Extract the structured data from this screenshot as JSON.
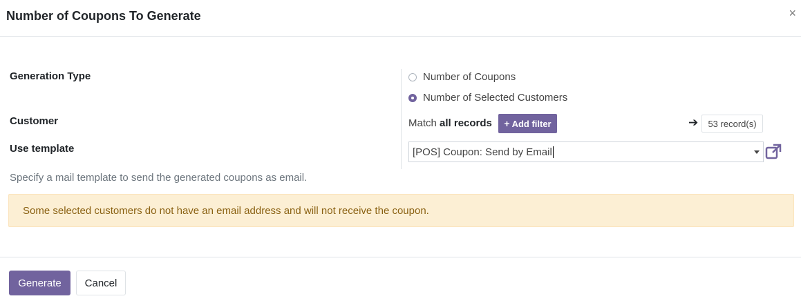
{
  "dialog": {
    "title": "Number of Coupons To Generate",
    "close_icon": "×"
  },
  "form": {
    "generation_type": {
      "label": "Generation Type",
      "options": [
        {
          "label": "Number of Coupons",
          "selected": false
        },
        {
          "label": "Number of Selected Customers",
          "selected": true
        }
      ]
    },
    "customer": {
      "label": "Customer",
      "match_prefix": "Match",
      "match_scope": "all records",
      "add_filter_label": "Add filter",
      "add_filter_icon": "+",
      "records_arrow": "➔",
      "records_count": "53 record(s)"
    },
    "use_template": {
      "label": "Use template",
      "value": "[POS] Coupon: Send by Email",
      "help": "Specify a mail template to send the generated coupons as email."
    }
  },
  "alert": {
    "text": "Some selected customers do not have an email address and will not receive the coupon."
  },
  "footer": {
    "generate_label": "Generate",
    "cancel_label": "Cancel"
  },
  "colors": {
    "primary": "#71639e",
    "alert_bg": "#fcefd4",
    "alert_text": "#8a6112"
  }
}
